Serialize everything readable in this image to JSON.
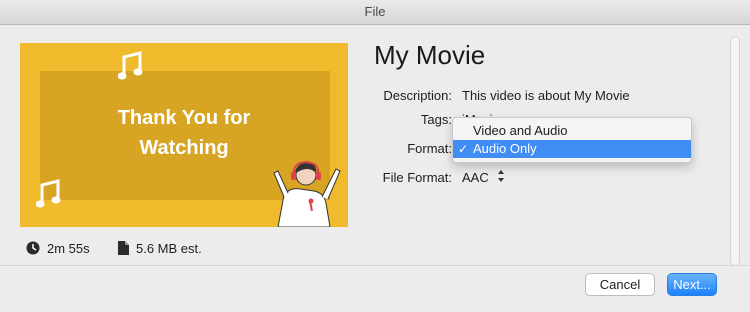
{
  "window": {
    "title": "File"
  },
  "thumbnail": {
    "line1": "Thank You for",
    "line2": "Watching"
  },
  "meta": {
    "duration": "2m 55s",
    "size": "5.6 MB est."
  },
  "movie": {
    "title": "My Movie",
    "description_label": "Description:",
    "description_value": "This video is about My Movie",
    "tags_label": "Tags:",
    "tags_value": "iMovie",
    "format_label": "Format:",
    "file_format_label": "File Format:",
    "file_format_value": "AAC"
  },
  "format_menu": {
    "options": [
      "Video and Audio",
      "Audio Only"
    ],
    "selected": "Audio Only",
    "check": "✓"
  },
  "buttons": {
    "cancel": "Cancel",
    "next": "Next..."
  },
  "colors": {
    "accent": "#3f8df5",
    "thumbnail_bg": "#efbb2c",
    "thumbnail_inner": "#d7a523"
  },
  "icons": [
    "clock-icon",
    "document-icon",
    "music-note-icon",
    "up-down-arrows-icon",
    "checkmark-icon"
  ]
}
